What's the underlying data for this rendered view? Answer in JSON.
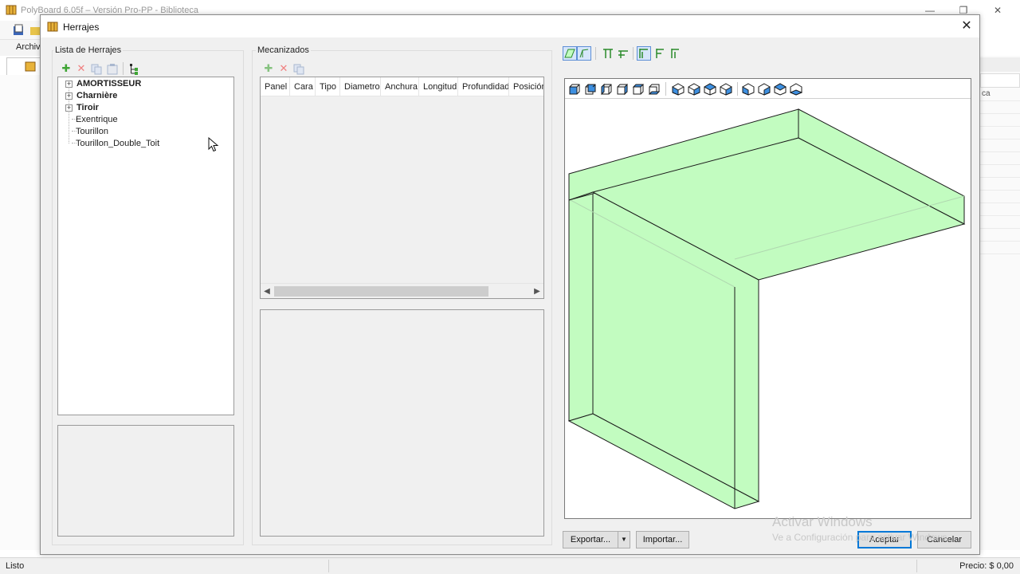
{
  "app": {
    "title": "PolyBoard 6.05f – Versión Pro-PP - Biblioteca",
    "menu_first": "Archiv",
    "right_pane_fragment": "ca",
    "status_left": "Listo",
    "status_right": "Precio: $ 0,00"
  },
  "dialog": {
    "title": "Herrajes",
    "close_symbol": "✕"
  },
  "hardware_list": {
    "label": "Lista de Herrajes",
    "toolbar": [
      "add-icon",
      "delete-icon",
      "copy-icon",
      "paste-icon",
      "tree-icon"
    ],
    "items": [
      {
        "label": "AMORTISSEUR",
        "bold": true,
        "expandable": true
      },
      {
        "label": "Charnière",
        "bold": true,
        "expandable": true
      },
      {
        "label": "Tiroir",
        "bold": true,
        "expandable": true
      },
      {
        "label": "Exentrique",
        "bold": false,
        "expandable": false
      },
      {
        "label": "Tourillon",
        "bold": false,
        "expandable": false
      },
      {
        "label": "Tourillon_Double_Toit",
        "bold": false,
        "expandable": false
      }
    ]
  },
  "machining": {
    "label": "Mecanizados",
    "columns": [
      "Panel",
      "Cara",
      "Tipo",
      "Diametro",
      "Anchura",
      "Longitud",
      "Profundidad",
      "Posición"
    ]
  },
  "viewer": {
    "panel_fill": "#c2fcc0",
    "edge_color": "#1a1a1a"
  },
  "buttons": {
    "export": "Exportar...",
    "import": "Importar...",
    "accept": "Aceptar",
    "cancel": "Cancelar"
  },
  "watermark": {
    "line1": "Activar Windows",
    "line2": "Ve a Configuración para activar Windows."
  },
  "colors": {
    "accent": "#0078d7",
    "add_green": "#3fa535",
    "panel_green": "#c2fcc0"
  }
}
